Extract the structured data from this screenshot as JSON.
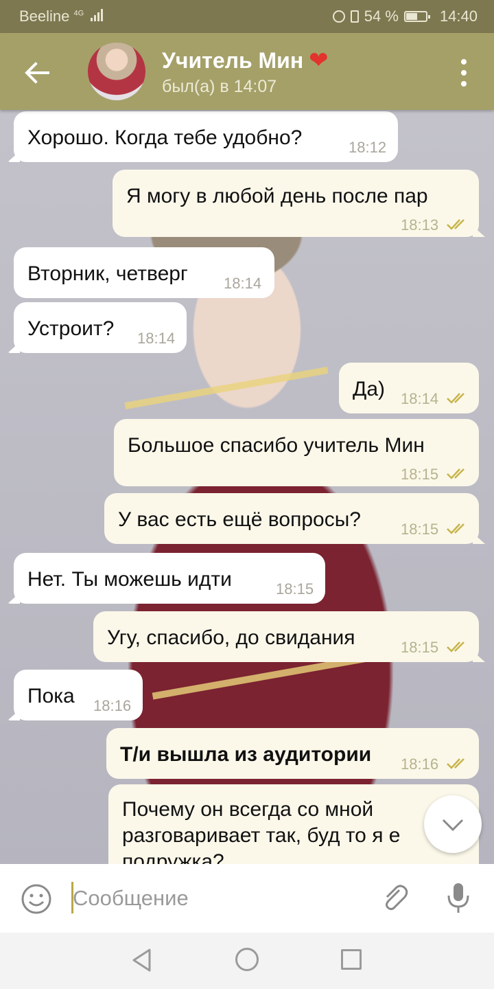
{
  "status_bar": {
    "carrier": "Beeline",
    "network": "4G",
    "battery": "54 %",
    "battery_level": 0.54,
    "time": "14:40"
  },
  "header": {
    "contact_name": "Учитель Мин",
    "status": "был(а) в 14:07",
    "heart": "❤"
  },
  "messages": [
    {
      "dir": "in",
      "text": "Хорошо. Когда тебе удобно?",
      "time": "18:12"
    },
    {
      "dir": "out",
      "text": "Я могу в любой день после пар",
      "time": "18:13",
      "read": true
    },
    {
      "dir": "in",
      "text": "Вторник, четверг",
      "time": "18:14"
    },
    {
      "dir": "in",
      "text": "Устроит?",
      "time": "18:14"
    },
    {
      "dir": "out",
      "text": "Да)",
      "time": "18:14",
      "read": true
    },
    {
      "dir": "out",
      "text": "Большое спасибо учитель Мин",
      "time": "18:15",
      "read": true
    },
    {
      "dir": "out",
      "text": "У вас есть ещё вопросы?",
      "time": "18:15",
      "read": true
    },
    {
      "dir": "in",
      "text": "Нет. Ты можешь идти",
      "time": "18:15"
    },
    {
      "dir": "out",
      "text": "Угу, спасибо, до свидания",
      "time": "18:15",
      "read": true
    },
    {
      "dir": "in",
      "text": "Пока",
      "time": "18:16"
    },
    {
      "dir": "out",
      "text": "Т/и вышла из аудитории",
      "time": "18:16",
      "read": true,
      "bold": true
    },
    {
      "dir": "out",
      "text_line1": "Почему он всегда со мной",
      "text_line2": "разговаривает так, буд то я е",
      "text_line3": "подружка?"
    }
  ],
  "input": {
    "placeholder": "Сообщение"
  },
  "colors": {
    "header_bg": "#a5a068",
    "status_bg": "#7d7850",
    "outgoing_bubble": "#fbf8ea",
    "incoming_bubble": "#ffffff",
    "read_ticks": "#c7b44a"
  }
}
